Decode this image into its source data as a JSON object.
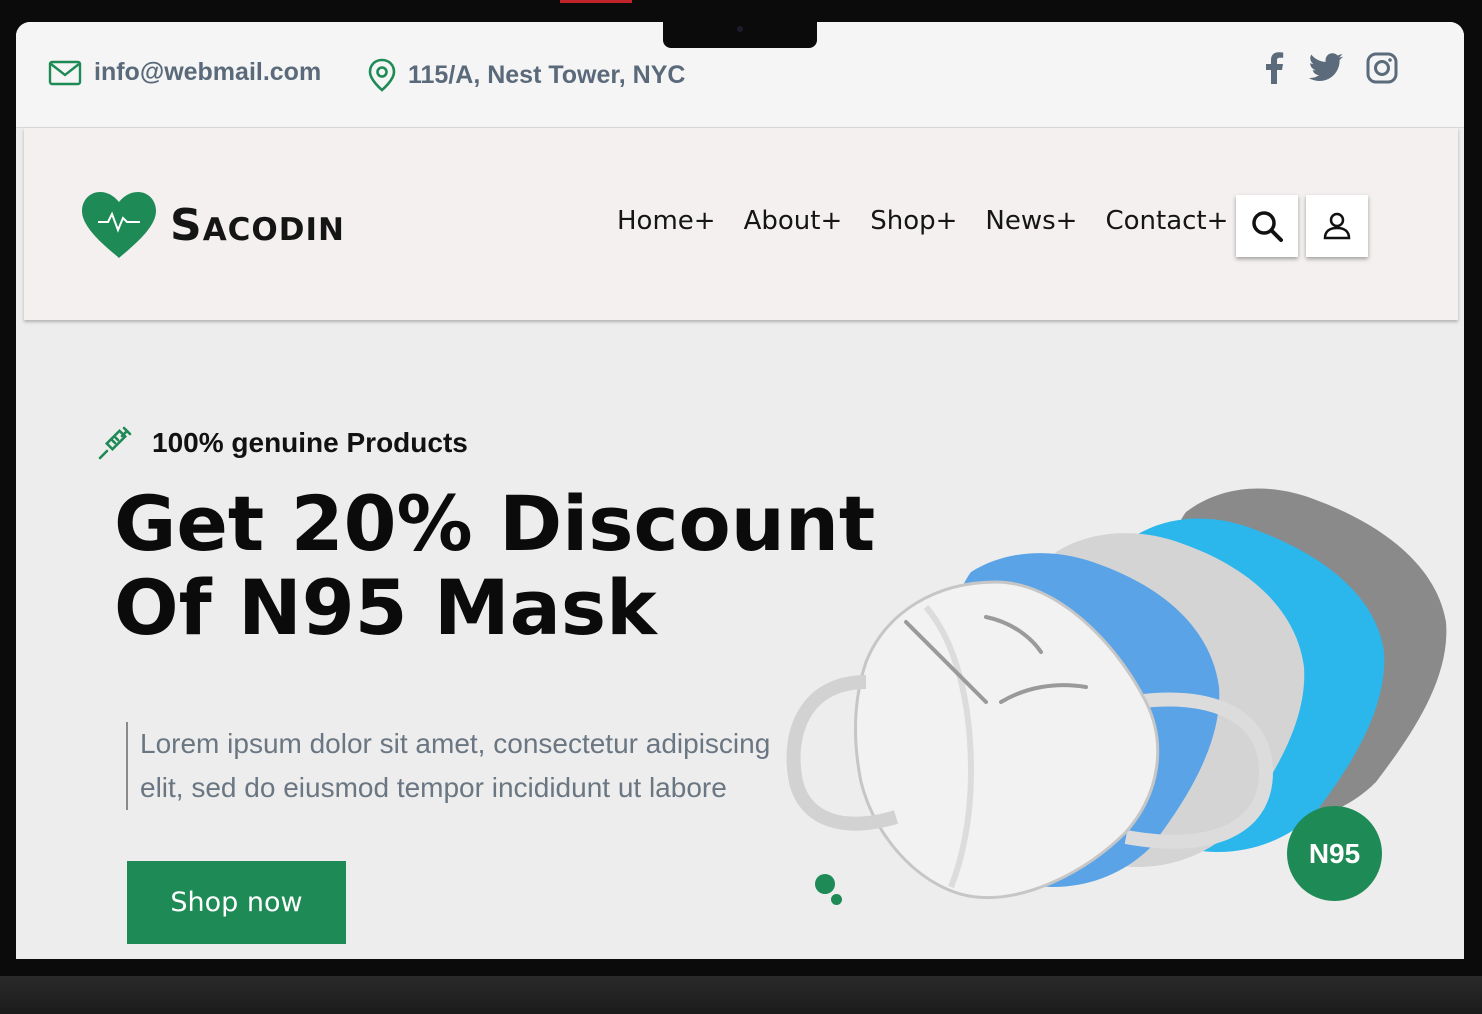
{
  "topbar": {
    "email": "info@webmail.com",
    "address": "115/A, Nest Tower, NYC",
    "icons": [
      "mail-icon",
      "location-pin-icon",
      "facebook-icon",
      "twitter-icon",
      "instagram-icon"
    ]
  },
  "header": {
    "logo_text": "Sacodin",
    "nav": [
      "Home+",
      "About+",
      "Shop+",
      "News+",
      "Contact+"
    ],
    "icons": [
      "heart-pulse-logo-icon",
      "search-icon",
      "user-icon"
    ]
  },
  "hero": {
    "tagline": "100% genuine Products",
    "headline_line1": "Get 20% Discount",
    "headline_line2": "Of N95 Mask",
    "description": "Lorem ipsum dolor sit amet, consectetur adipiscing elit, sed do eiusmod tempor incididunt ut labore",
    "cta_label": "Shop now",
    "badge": "N95",
    "icons": [
      "syringe-icon"
    ]
  },
  "colors": {
    "brand_green": "#1e8a55",
    "text_dark": "#0b0b0b",
    "text_muted": "#6a7682",
    "mask_blue": "#5aa3e6",
    "mask_cyan": "#2bb7ec",
    "mask_gray": "#8a8a8a"
  }
}
